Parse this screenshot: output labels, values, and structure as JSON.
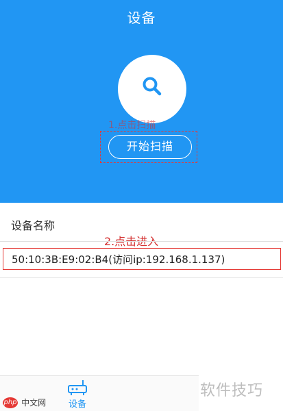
{
  "header": {
    "title": "设备",
    "annotation": "1.点击扫描",
    "scan_button_label": "开始扫描",
    "background_color": "#2196f3",
    "search_icon": "search-icon"
  },
  "device_list": {
    "header": "设备名称",
    "annotation": "2.点击进入",
    "items": [
      {
        "label": "50:10:3B:E9:02:B4(访问ip:192.168.1.137)"
      }
    ]
  },
  "bottom_nav": {
    "items": [
      {
        "icon": "router-icon",
        "label": "设备",
        "active": true,
        "color": "#2196f3"
      }
    ]
  },
  "watermark": {
    "right_text": "软件技巧",
    "left_logo": "php",
    "left_text": "中文网"
  },
  "colors": {
    "accent": "#2196f3",
    "annotation_red": "#e53935"
  }
}
